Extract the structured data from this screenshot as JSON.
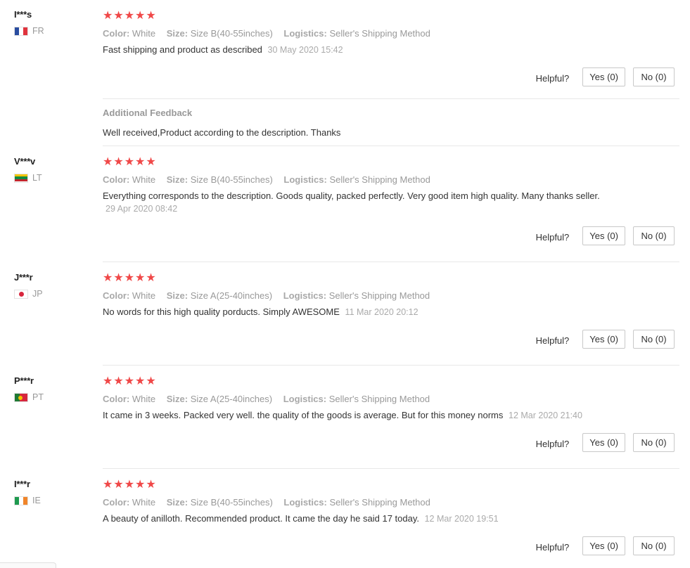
{
  "labels": {
    "color_key": "Color:",
    "size_key": "Size:",
    "logistics_key": "Logistics:",
    "helpful": "Helpful?",
    "additional_feedback": "Additional Feedback"
  },
  "stars": "★★★★★",
  "reviews": [
    {
      "user": "I***s",
      "country": "FR",
      "flag_colors": [
        "#2a4da0",
        "#ffffff",
        "#e0333d"
      ],
      "rating": 5,
      "color": "White",
      "size": "Size B(40-55inches)",
      "logistics": "Seller's Shipping Method",
      "text": "Fast shipping and product as described",
      "date": "30 May 2020 15:42",
      "yes": "Yes (0)",
      "no": "No (0)",
      "additional": "Well received,Product according to the description. Thanks"
    },
    {
      "user": "V***v",
      "country": "LT",
      "flag_colors": [
        "#f5c400",
        "#138a42",
        "#c1272d"
      ],
      "rating": 5,
      "color": "White",
      "size": "Size B(40-55inches)",
      "logistics": "Seller's Shipping Method",
      "text": "Everything corresponds to the description. Goods quality, packed perfectly. Very good item high quality. Many thanks seller.",
      "date": "29 Apr 2020 08:42",
      "yes": "Yes (0)",
      "no": "No (0)"
    },
    {
      "user": "J***r",
      "country": "JP",
      "flag_colors": [
        "#ffffff",
        "#d7263d"
      ],
      "rating": 5,
      "color": "White",
      "size": "Size A(25-40inches)",
      "logistics": "Seller's Shipping Method",
      "text": "No words for this high quality porducts. Simply AWESOME",
      "date": "11 Mar 2020 20:12",
      "yes": "Yes (0)",
      "no": "No (0)"
    },
    {
      "user": "P***r",
      "country": "PT",
      "flag_colors": [
        "#1f7a34",
        "#d7263d",
        "#f5c400"
      ],
      "rating": 5,
      "color": "White",
      "size": "Size A(25-40inches)",
      "logistics": "Seller's Shipping Method",
      "text": "It came in 3 weeks. Packed very well. the quality of the goods is average. But for this money norms",
      "date": "12 Mar 2020 21:40",
      "yes": "Yes (0)",
      "no": "No (0)"
    },
    {
      "user": "I***r",
      "country": "IE",
      "flag_colors": [
        "#1e9a4f",
        "#ffffff",
        "#f0852a"
      ],
      "rating": 5,
      "color": "White",
      "size": "Size B(40-55inches)",
      "logistics": "Seller's Shipping Method",
      "text": "A beauty of anilloth. Recommended product. It came the day he said 17 today.",
      "date": "12 Mar 2020 19:51",
      "yes": "Yes (0)",
      "no": "No (0)"
    }
  ]
}
